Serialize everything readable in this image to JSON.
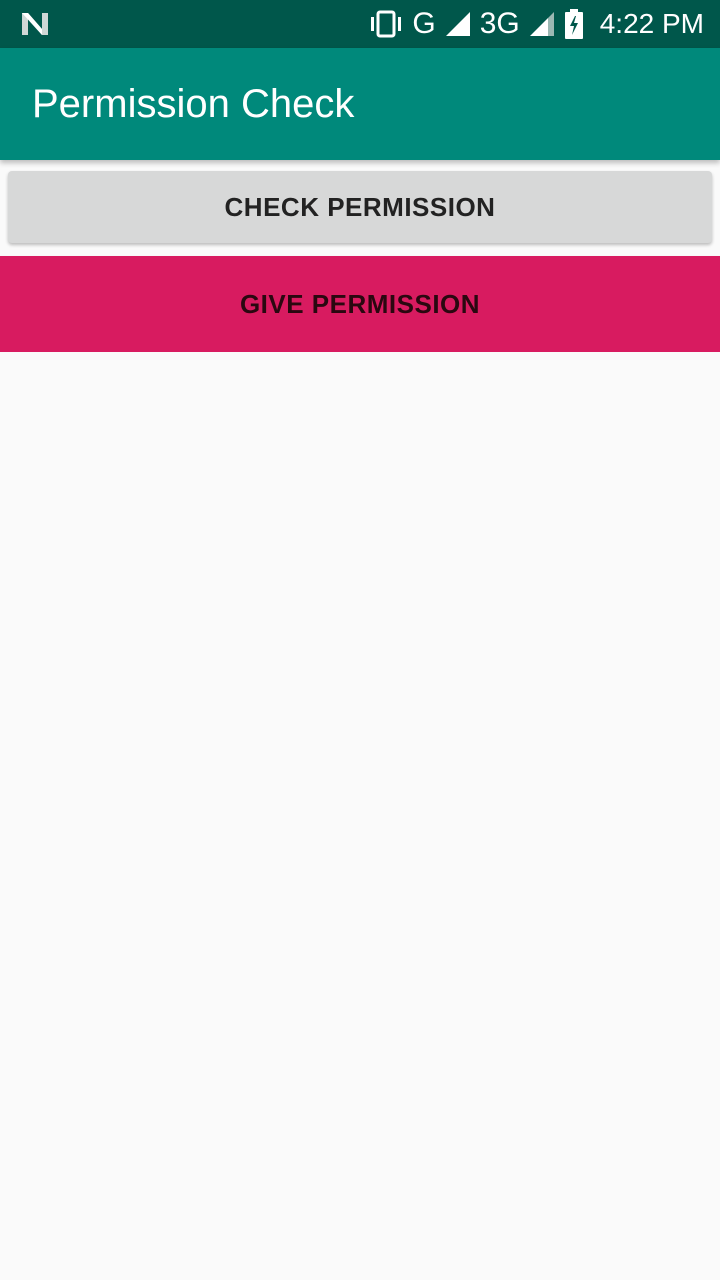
{
  "status_bar": {
    "left_icon": "nougat-n-icon",
    "icons": [
      "vibrate-icon",
      "signal-icon",
      "signal-3g-icon",
      "battery-charging-icon"
    ],
    "network_1": "G",
    "network_2": "3G",
    "time": "4:22 PM",
    "color": "#00574b"
  },
  "app_bar": {
    "title": "Permission Check",
    "color": "#00897b"
  },
  "buttons": {
    "check_permission": "CHECK PERMISSION",
    "give_permission": "GIVE PERMISSION",
    "give_color": "#d81b60",
    "check_color": "#d7d8d8"
  }
}
